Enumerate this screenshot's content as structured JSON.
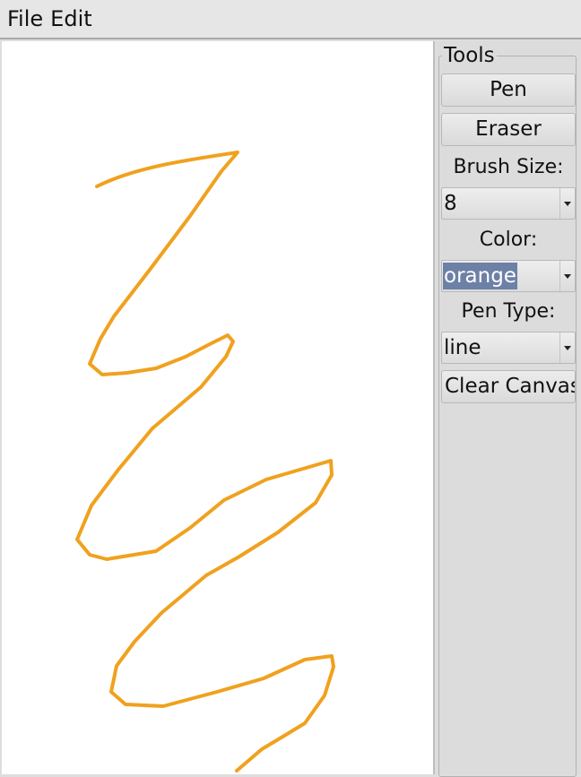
{
  "menu": {
    "items": [
      "File",
      "Edit"
    ]
  },
  "tools": {
    "title": "Tools",
    "pen_label": "Pen",
    "eraser_label": "Eraser",
    "brush_size_label": "Brush Size:",
    "brush_size_value": "8",
    "color_label": "Color:",
    "color_value": "orange",
    "pen_type_label": "Pen Type:",
    "pen_type_value": "line",
    "clear_label": "Clear Canvas"
  },
  "canvas": {
    "stroke_color": "#f0a11e",
    "stroke_width": 4
  },
  "colors": {
    "menubar_bg": "#e6e6e6",
    "panel_bg": "#dcdcdc",
    "selection_highlight": "#6d80a6",
    "canvas_bg": "#ffffff"
  }
}
